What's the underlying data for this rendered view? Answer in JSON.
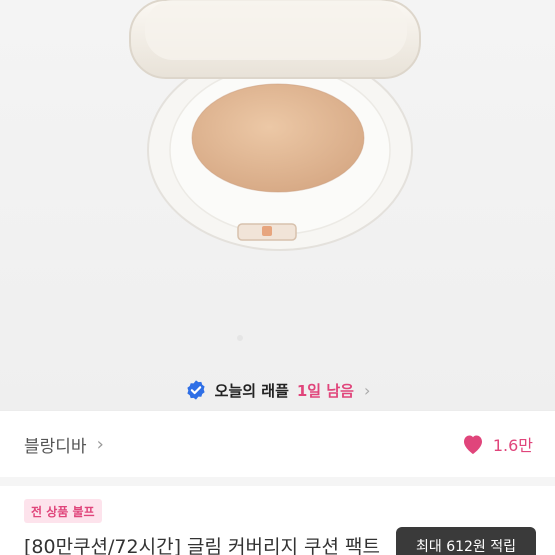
{
  "raffle": {
    "label": "오늘의 래플",
    "remaining": "1일 남음",
    "icon": "verified-badge-icon",
    "color": "#2f6fe6"
  },
  "store": {
    "name": "블랑디바"
  },
  "likes": {
    "count": "1.6만",
    "icon": "heart-icon",
    "color": "#e0457b"
  },
  "product": {
    "tag": "전 상품 불프",
    "title": "[80만쿠션/72시간] 글림 커버리지 쿠션 팩트"
  },
  "points_tooltip": "최대 612원 적립",
  "accent_color": "#e0457b"
}
